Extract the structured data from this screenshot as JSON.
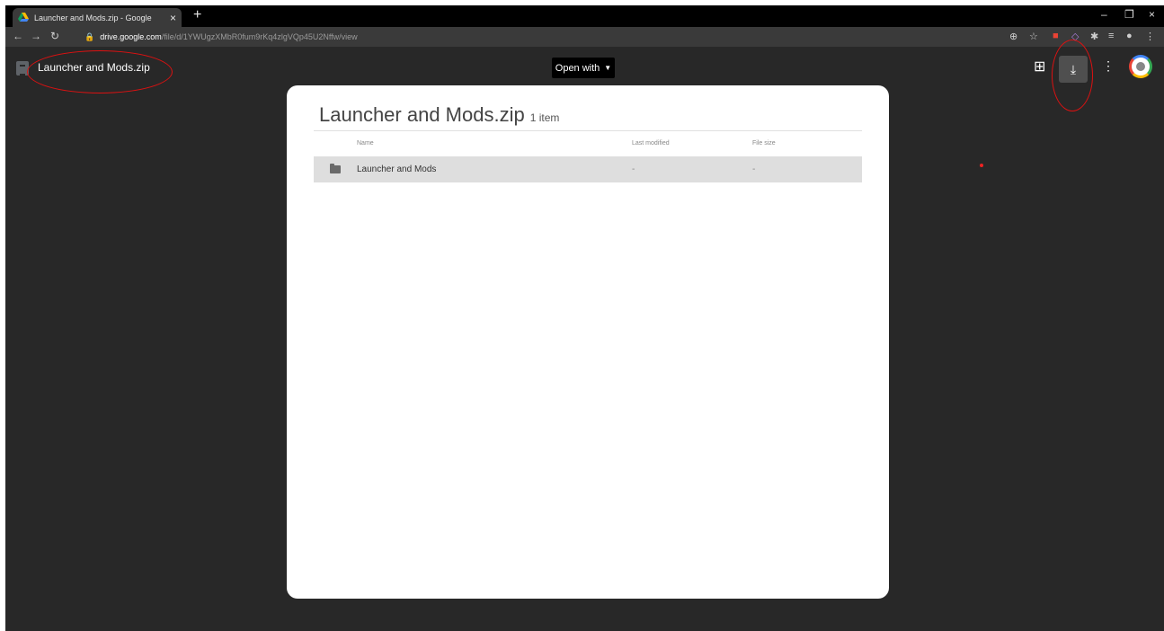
{
  "browser": {
    "tab_title": "Launcher and Mods.zip - Google",
    "tab_close": "×",
    "new_tab": "+",
    "minimize": "–",
    "restore": "❐",
    "close": "×",
    "url_host": "drive.google.com",
    "url_path": "/file/d/1YWUgzXMbR0fum9rKq4zlgVQp45U2Nffw/view"
  },
  "viewer": {
    "file_name": "Launcher and Mods.zip",
    "open_with": "Open with"
  },
  "card": {
    "title": "Launcher and Mods.zip",
    "count": "1 item",
    "columns": [
      "Name",
      "Last modified",
      "File size"
    ],
    "rows": [
      {
        "name": "Launcher and Mods",
        "modified": "-",
        "size": "-"
      }
    ]
  },
  "colors": {
    "viewer_bg": "#282828",
    "annotation": "#dd1111"
  }
}
